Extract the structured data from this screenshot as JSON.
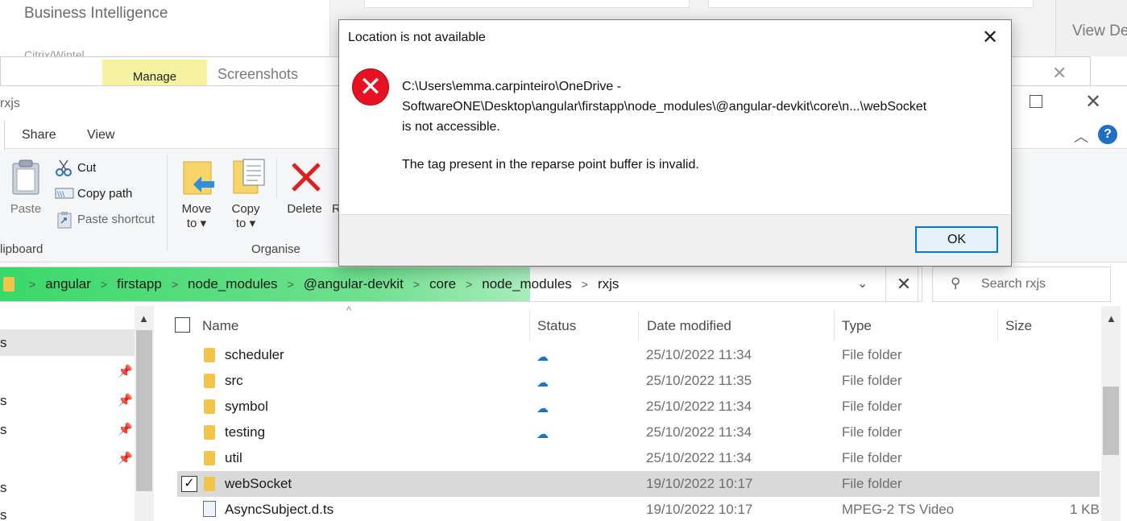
{
  "background_app": {
    "title": "Business Intelligence",
    "subtitle": "Citrix/Wintel",
    "view_details": "View De"
  },
  "back_window": {
    "manage_tab": "Manage",
    "title": "Screenshots",
    "close": "✕"
  },
  "explorer": {
    "title_partial": "rxjs",
    "close": "✕",
    "tabs": {
      "share": "Share",
      "view": "View"
    },
    "help": "?",
    "ribbon": {
      "paste": "Paste",
      "cut": "Cut",
      "copy_path": "Copy path",
      "paste_shortcut": "Paste shortcut",
      "clipboard_group": "lipboard",
      "move_to_line1": "Move",
      "move_to_line2": "to ▾",
      "copy_to_line1": "Copy",
      "copy_to_line2": "to ▾",
      "delete": "Delete",
      "rename_partial": "R",
      "organise_group": "Organise"
    },
    "address": {
      "crumbs": [
        "angular",
        "firstapp",
        "node_modules",
        "@angular-devkit",
        "core",
        "node_modules",
        "rxjs"
      ],
      "dropdown": "⌄",
      "clear": "✕"
    },
    "search": {
      "placeholder": "Search rxjs",
      "icon": "search-icon"
    },
    "nav": {
      "items": [
        "s",
        "s",
        "s",
        "s",
        "s"
      ]
    },
    "columns": {
      "name": "Name",
      "status": "Status",
      "date_modified": "Date modified",
      "type": "Type",
      "size": "Size"
    },
    "rows": [
      {
        "name": "scheduler",
        "icon": "folder-icon",
        "status": "cloud",
        "date": "25/10/2022 11:34",
        "type": "File folder",
        "size": ""
      },
      {
        "name": "src",
        "icon": "folder-icon",
        "status": "cloud",
        "date": "25/10/2022 11:35",
        "type": "File folder",
        "size": ""
      },
      {
        "name": "symbol",
        "icon": "folder-icon",
        "status": "cloud",
        "date": "25/10/2022 11:34",
        "type": "File folder",
        "size": ""
      },
      {
        "name": "testing",
        "icon": "folder-icon",
        "status": "cloud",
        "date": "25/10/2022 11:34",
        "type": "File folder",
        "size": ""
      },
      {
        "name": "util",
        "icon": "folder-icon",
        "status": "",
        "date": "25/10/2022 11:34",
        "type": "File folder",
        "size": ""
      },
      {
        "name": "webSocket",
        "icon": "folder-icon",
        "status": "",
        "date": "19/10/2022 10:17",
        "type": "File folder",
        "size": "",
        "selected": true
      },
      {
        "name": "AsyncSubject.d.ts",
        "icon": "file-icon",
        "status": "",
        "date": "19/10/2022 10:17",
        "type": "MPEG-2 TS Video",
        "size": "1 KB"
      }
    ]
  },
  "dialog": {
    "title": "Location is not available",
    "close": "✕",
    "icon": "error-icon",
    "message_line1": "C:\\Users\\emma.carpinteiro\\OneDrive -",
    "message_line2": "SoftwareONE\\Desktop\\angular\\firstapp\\node_modules\\@angular-devkit\\core\\n...\\webSocket",
    "message_line3": "is not accessible.",
    "detail": "The tag present in the reparse point buffer is invalid.",
    "ok": "OK"
  },
  "colors": {
    "accent": "#0078d7",
    "error": "#e81123",
    "folder": "#f3c44a",
    "cloud": "#1a73c9",
    "address_highlight": "#3ad86a",
    "manage_tab": "#f6f3a0"
  }
}
